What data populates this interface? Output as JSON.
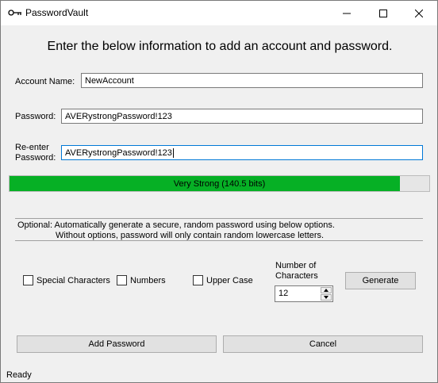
{
  "window": {
    "title": "PasswordVault",
    "icon": "key-icon",
    "controls": [
      "minimize-icon",
      "maximize-icon",
      "close-icon"
    ]
  },
  "headline": "Enter the below information to add an account and password.",
  "form": {
    "account_label": "Account Name:",
    "account_value": "NewAccount",
    "password_label": "Password:",
    "password_value": "AVERystrongPassword!123",
    "reenter_label_line1": "Re-enter",
    "reenter_label_line2": "Password:",
    "reenter_value": "AVERystrongPassword!123"
  },
  "strength": {
    "text": "Very Strong (140.5 bits)",
    "fill_fraction": 0.93,
    "color": "#06b025"
  },
  "optional": {
    "line1": "Optional: Automatically generate a secure, random password using below options.",
    "line2": "Without options, password will only contain random lowercase letters."
  },
  "options": {
    "special_chars": {
      "label": "Special Characters",
      "checked": false
    },
    "numbers": {
      "label": "Numbers",
      "checked": false
    },
    "upper_case": {
      "label": "Upper Case",
      "checked": false
    },
    "num_chars_label_line1": "Number of",
    "num_chars_label_line2": "Characters",
    "num_chars_value": "12",
    "generate_label": "Generate"
  },
  "actions": {
    "add_label": "Add Password",
    "cancel_label": "Cancel"
  },
  "status": "Ready"
}
